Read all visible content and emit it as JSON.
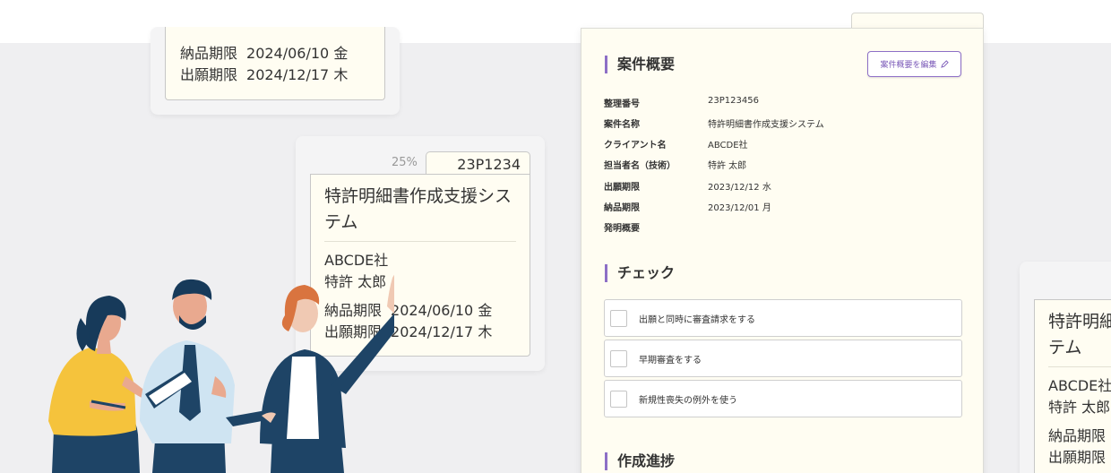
{
  "cards": [
    {
      "id": "top",
      "deadlines": [
        {
          "label": "納品期限",
          "value": "2024/06/10 金"
        },
        {
          "label": "出願期限",
          "value": "2024/12/17 木"
        }
      ]
    },
    {
      "id": "middle",
      "progress": "25%",
      "number": "23P1234",
      "title_line1": "特許明細書作成支援シス",
      "title_line2": "テム",
      "client": "ABCDE社",
      "person": "特許 太郎",
      "deadlines": [
        {
          "label": "納品期限",
          "value": "2024/06/10 金"
        },
        {
          "label": "出願期限",
          "value": "2024/12/17 木"
        }
      ]
    },
    {
      "id": "right",
      "title_line1": "特許明細",
      "title_line2": "テム",
      "client": "ABCDE社",
      "person": "特許 太郎",
      "deadlines": [
        {
          "label": "納品期限"
        },
        {
          "label": "出願期限"
        }
      ]
    }
  ],
  "panel": {
    "summary_title": "案件概要",
    "edit_button": "案件概要を編集",
    "fields": [
      {
        "label": "整理番号",
        "value": "23P123456"
      },
      {
        "label": "案件名称",
        "value": "特許明細書作成支援システム"
      },
      {
        "label": "クライアント名",
        "value": "ABCDE社"
      },
      {
        "label": "担当者名（技術）",
        "value": "特許 太郎"
      },
      {
        "label": "出願期限",
        "value": "2023/12/12 水"
      },
      {
        "label": "納品期限",
        "value": "2023/12/01 月"
      },
      {
        "label": "発明概要",
        "value": ""
      }
    ],
    "check_title": "チェック",
    "checks": [
      {
        "label": "出願と同時に審査請求をする",
        "checked": false
      },
      {
        "label": "早期審査をする",
        "checked": false
      },
      {
        "label": "新規性喪失の例外を使う",
        "checked": false
      }
    ],
    "progress_title": "作成進捗"
  },
  "colors": {
    "accent": "#8d6fc6",
    "card_bg": "#fffdf2",
    "page_bg": "#efeff1"
  },
  "icons": {
    "edit": "pencil-icon"
  }
}
